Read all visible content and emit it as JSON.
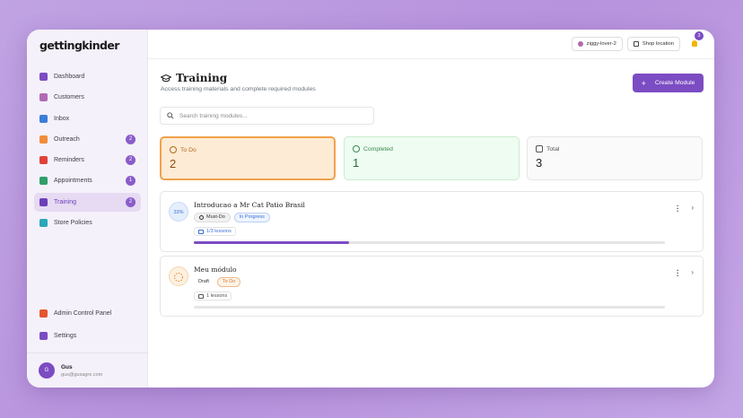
{
  "app": {
    "logo": "gettingkinder"
  },
  "sidebar": {
    "items": [
      {
        "label": "Dashboard",
        "icon": "dashboard-icon",
        "color": "#7c4cc2",
        "badge": "",
        "active": false
      },
      {
        "label": "Customers",
        "icon": "customers-icon",
        "color": "#b06ab3",
        "badge": "",
        "active": false
      },
      {
        "label": "Inbox",
        "icon": "inbox-icon",
        "color": "#3b7dd8",
        "badge": "",
        "active": false
      },
      {
        "label": "Outreach",
        "icon": "outreach-icon",
        "color": "#f08c3a",
        "badge": "2",
        "active": false
      },
      {
        "label": "Reminders",
        "icon": "reminders-icon",
        "color": "#e0423a",
        "badge": "2",
        "active": false
      },
      {
        "label": "Appointments",
        "icon": "appointments-icon",
        "color": "#2f9e6a",
        "badge": "1",
        "active": false
      },
      {
        "label": "Training",
        "icon": "training-icon",
        "color": "#6d3fb8",
        "badge": "2",
        "active": true
      },
      {
        "label": "Store Policies",
        "icon": "store-policies-icon",
        "color": "#2aa7b8",
        "badge": "",
        "active": false
      }
    ],
    "bottom": [
      {
        "label": "Admin Control Panel",
        "icon": "shield-icon",
        "color": "#e5542f"
      },
      {
        "label": "Settings",
        "icon": "gear-icon",
        "color": "#7c4cc2"
      }
    ],
    "user": {
      "initial": "G",
      "name": "Gus",
      "email": "gus@gusagre.com"
    }
  },
  "topbar": {
    "store_label": "ziggy-lover-2",
    "shop_location_label": "Shop location",
    "notification_count": "3"
  },
  "header": {
    "title": "Training",
    "subtitle": "Access training materials and complete required modules",
    "create_label": "Create Module"
  },
  "search": {
    "placeholder": "Search training modules..."
  },
  "stats": {
    "todo": {
      "label": "To Do",
      "value": "2"
    },
    "completed": {
      "label": "Completed",
      "value": "1"
    },
    "total": {
      "label": "Total",
      "value": "3"
    }
  },
  "modules": [
    {
      "progress_label": "33%",
      "title": "Introducao a Mr Cat Patio Brasil",
      "tags": [
        "Must-Do",
        "In Progress"
      ],
      "lessons": "1/3 lessons",
      "progress": 0.33
    },
    {
      "progress_label": "",
      "title": "Meu módulo",
      "tags": [
        "Draft",
        "To Do"
      ],
      "lessons": "1 lessons",
      "progress": 0
    }
  ],
  "colors": {
    "accent": "#7c4cc2",
    "todo": "#f0a24d",
    "completed": "#3b8a4e"
  }
}
